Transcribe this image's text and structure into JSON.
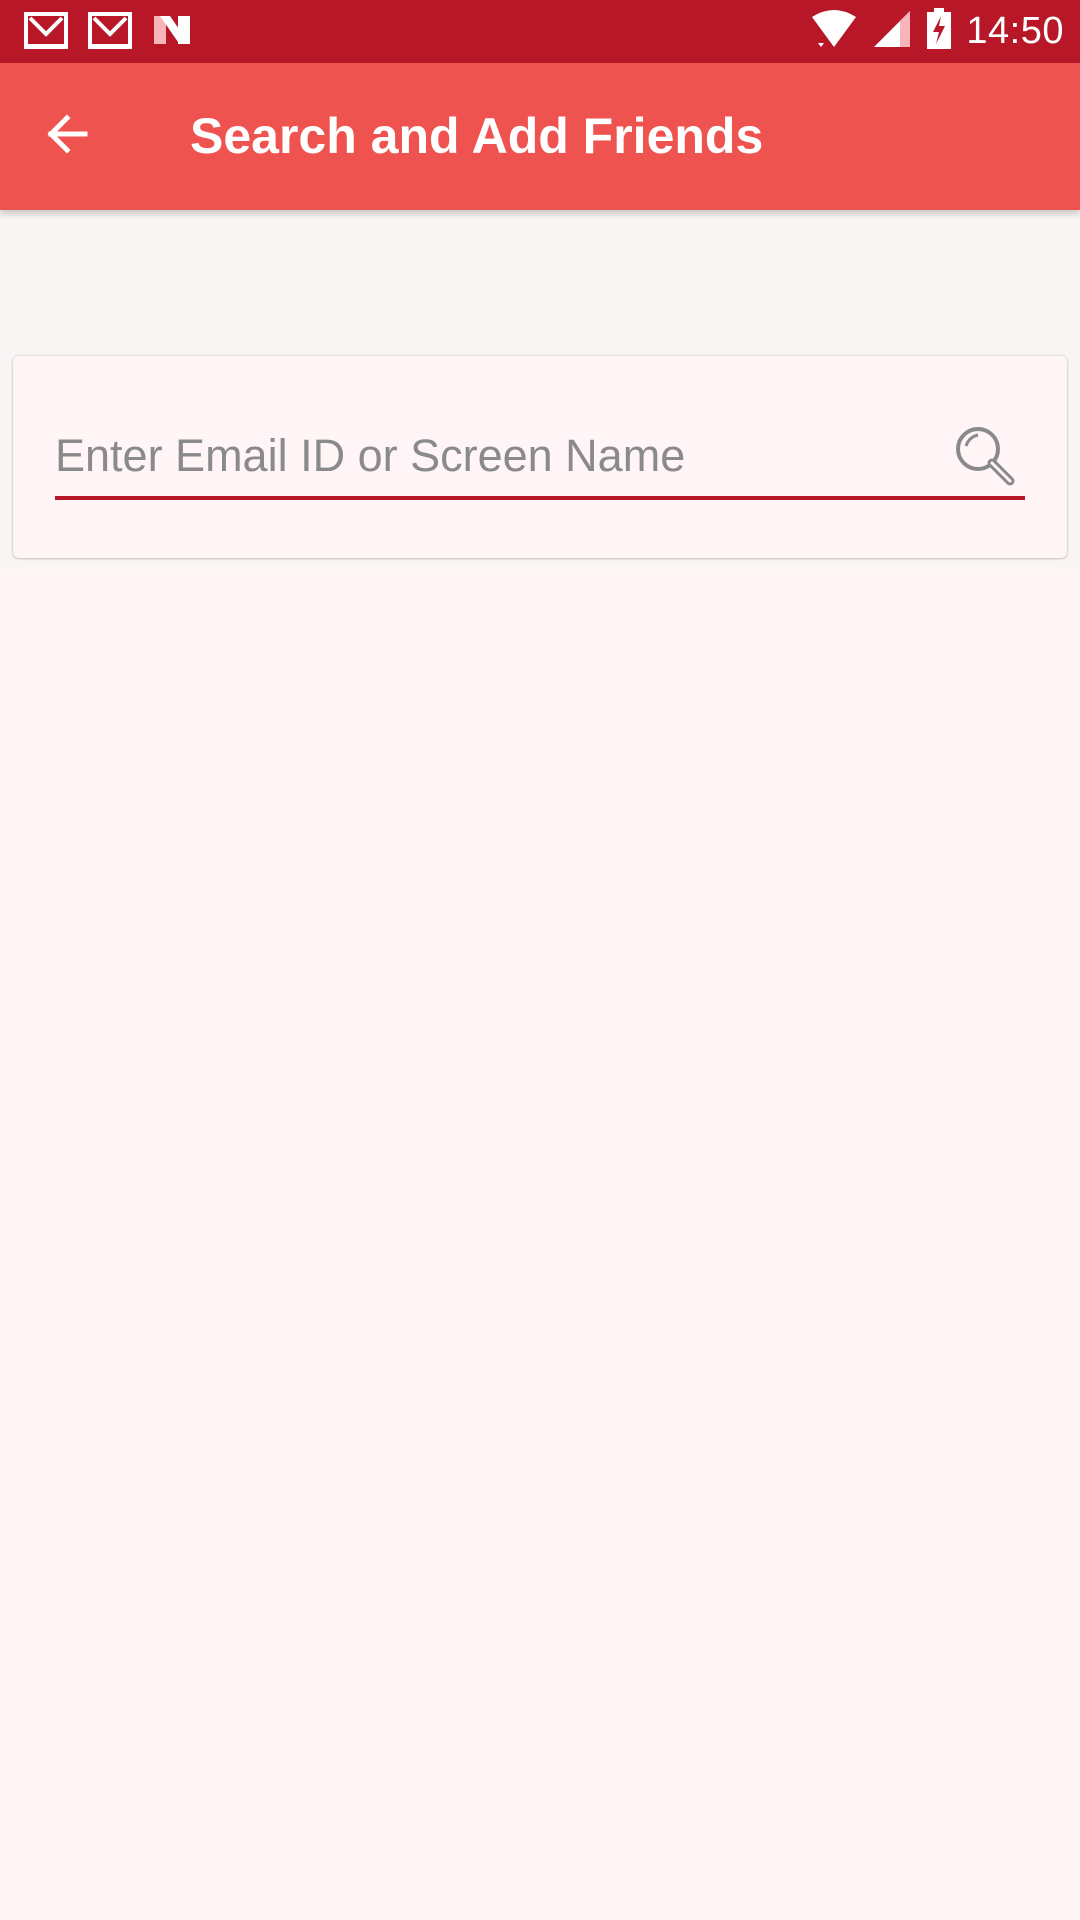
{
  "status_bar": {
    "time": "14:50",
    "left_icons": [
      "gmail-icon",
      "gmail-icon",
      "n-notification-icon"
    ],
    "right_icons": [
      "wifi-icon",
      "cell-signal-icon",
      "battery-charging-icon"
    ]
  },
  "app_bar": {
    "title": "Search and Add Friends",
    "back_icon": "arrow-back-icon"
  },
  "search": {
    "placeholder": "Enter Email ID or Screen Name",
    "value": "",
    "icon": "search-icon"
  },
  "colors": {
    "status_bar": "#b71727",
    "app_bar": "#ef5350",
    "accent_underline": "#b71727",
    "background": "#fff5f6"
  }
}
